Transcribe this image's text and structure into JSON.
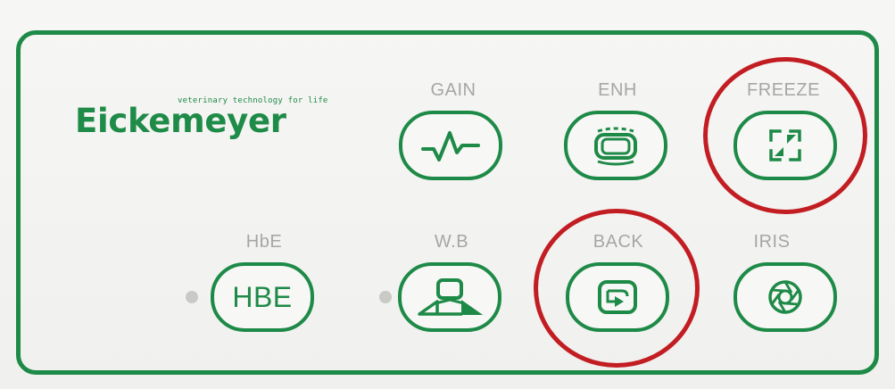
{
  "brand": {
    "tagline": "veterinary technology for life",
    "name": "Eickemeyer"
  },
  "colors": {
    "panel": "#f3f3f1",
    "accent_green": "#1e8a47",
    "label_gray": "#a6a6a6",
    "highlight_red": "#c21d22",
    "indicator_gray": "#c9c9c6"
  },
  "buttons": {
    "gain": {
      "label": "GAIN",
      "icon": "waveform-icon"
    },
    "enh": {
      "label": "ENH",
      "icon": "enhance-screen-icon"
    },
    "freeze": {
      "label": "FREEZE",
      "icon": "freeze-arrows-icon"
    },
    "hbe": {
      "label": "HbE",
      "icon_text": "HBE"
    },
    "wb": {
      "label": "W.B",
      "icon": "white-balance-icon"
    },
    "back": {
      "label": "BACK",
      "icon": "back-arrow-icon"
    },
    "iris": {
      "label": "IRIS",
      "icon": "aperture-icon"
    }
  },
  "annotations": [
    {
      "target": "freeze",
      "shape": "circle",
      "color": "#c21d22"
    },
    {
      "target": "back",
      "shape": "circle",
      "color": "#c21d22"
    }
  ]
}
